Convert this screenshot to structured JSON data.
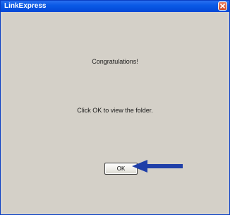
{
  "window": {
    "title": "LinkExpress"
  },
  "dialog": {
    "heading": "Congratulations!",
    "message": "Click OK to view the folder.",
    "ok_label": "OK"
  },
  "colors": {
    "titlebar": "#0a5ae6",
    "client": "#d4d0c8",
    "annotation_arrow": "#1f3fa8"
  },
  "icons": {
    "close": "close-icon",
    "annotation": "arrow-left-icon"
  }
}
